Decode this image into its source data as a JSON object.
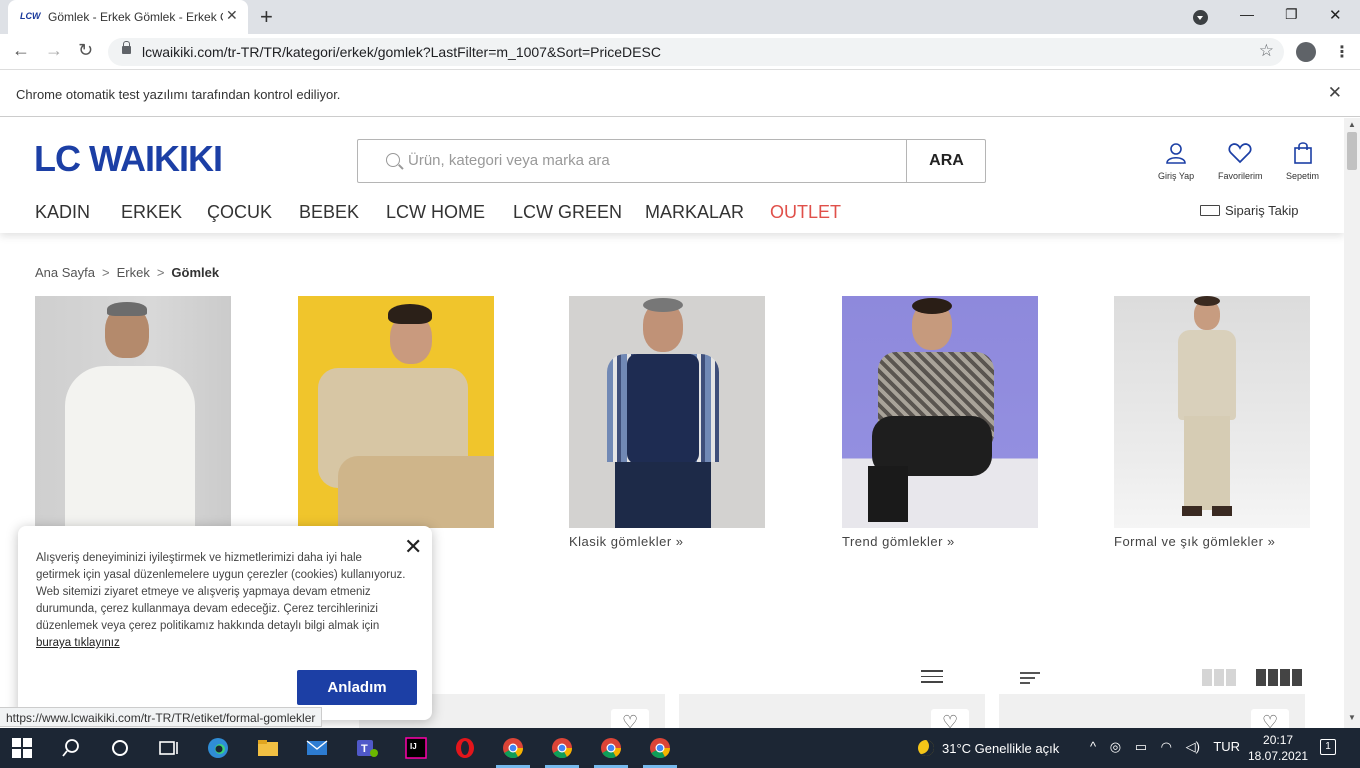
{
  "browser": {
    "tab_title": "Gömlek - Erkek Gömlek - Erkek G",
    "tab_favicon": "LCW",
    "url": "lcwaikiki.com/tr-TR/TR/kategori/erkek/gomlek?LastFilter=m_1007&Sort=PriceDESC",
    "infobar_text": "Chrome otomatik test yazılımı tarafından kontrol ediliyor."
  },
  "site": {
    "logo": "LC WAIKIKI",
    "search_placeholder": "Ürün, kategori veya marka ara",
    "search_button": "ARA",
    "header_icons": {
      "login": "Giriş Yap",
      "favorites": "Favorilerim",
      "cart": "Sepetim"
    },
    "nav": [
      "KADIN",
      "ERKEK",
      "ÇOCUK",
      "BEBEK",
      "LCW HOME",
      "LCW GREEN",
      "MARKALAR",
      "OUTLET"
    ],
    "order_track": "Sipariş Takip",
    "accent_color": "#1c3fa5",
    "outlet_color": "#e0504a"
  },
  "breadcrumb": {
    "home": "Ana Sayfa",
    "sep": ">",
    "parent": "Erkek",
    "current": "Gömlek"
  },
  "categories": [
    {
      "label": ""
    },
    {
      "label": "»"
    },
    {
      "label": "Klasik gömlekler  »"
    },
    {
      "label": "Trend gömlekler  »"
    },
    {
      "label": "Formal ve şık gömlekler »"
    }
  ],
  "cookie": {
    "text": "Alışveriş deneyiminizi iyileştirmek ve hizmetlerimizi daha iyi hale getirmek için yasal düzenlemelere uygun çerezler (cookies) kullanıyoruz. Web sitemizi ziyaret etmeye ve alışveriş yapmaya devam etmeniz durumunda, çerez kullanmaya devam edeceğiz. Çerez tercihlerinizi düzenlemek veya çerez politikamız hakkında detaylı bilgi almak için ",
    "link": "buraya tıklayınız",
    "button": "Anladım"
  },
  "status_url": "https://www.lcwaikiki.com/tr-TR/TR/etiket/formal-gomlekler",
  "taskbar": {
    "weather": "31°C  Genellikle açık",
    "lang": "TUR",
    "time": "20:17",
    "date": "18.07.2021",
    "notifications": "1"
  }
}
